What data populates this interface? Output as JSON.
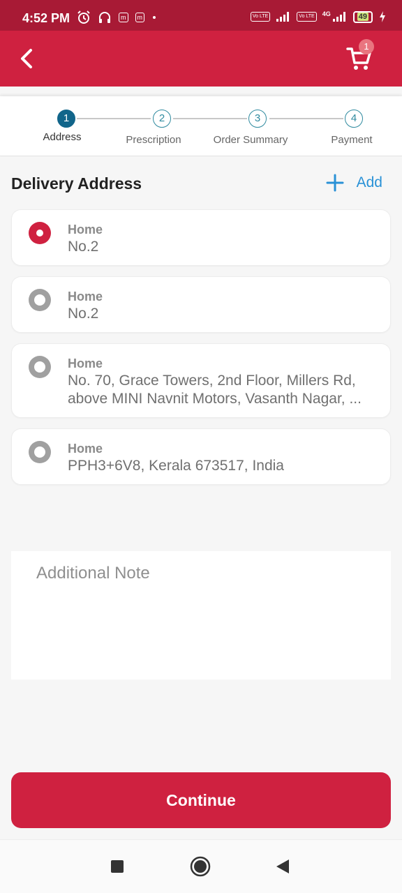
{
  "status_bar": {
    "time": "4:52 PM",
    "icons_left": [
      "alarm-icon",
      "headset-icon",
      "m-app-icon",
      "m-app-icon",
      "dot-icon"
    ],
    "app_badge": "m",
    "volte_label": "Vo LTE",
    "network_label": "4G",
    "battery_level": "49"
  },
  "app_bar": {
    "background": "#cf2140",
    "cart_count": "1"
  },
  "stepper": {
    "steps": [
      {
        "number": "1",
        "label": "Address",
        "active": true
      },
      {
        "number": "2",
        "label": "Prescription",
        "active": false
      },
      {
        "number": "3",
        "label": "Order Summary",
        "active": false
      },
      {
        "number": "4",
        "label": "Payment",
        "active": false
      }
    ]
  },
  "delivery": {
    "title": "Delivery Address",
    "add_label": "Add"
  },
  "addresses": [
    {
      "label": "Home",
      "text": "No.2",
      "selected": true
    },
    {
      "label": "Home",
      "text": "No.2",
      "selected": false
    },
    {
      "label": "Home",
      "line1": "No. 70, Grace Towers, 2nd Floor, Millers Rd,",
      "line2": "above MINI Navnit Motors, Vasanth Nagar, ...",
      "selected": false
    },
    {
      "label": "Home",
      "text": "PPH3+6V8, Kerala 673517, India",
      "selected": false
    }
  ],
  "note": {
    "placeholder": "Additional Note"
  },
  "continue_label": "Continue",
  "colors": {
    "primary": "#cf2140",
    "status_bar": "#a81a35",
    "step_active": "#11658a",
    "step_outline": "#2f8a9f",
    "link": "#2991d6"
  }
}
